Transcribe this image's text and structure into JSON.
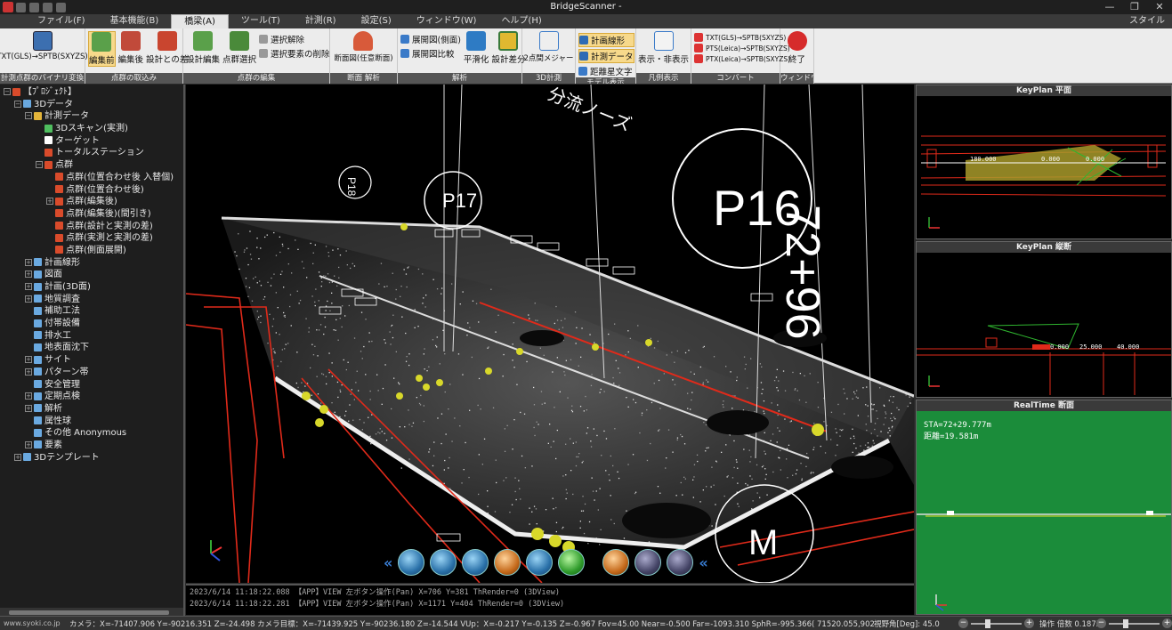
{
  "window": {
    "title": "BridgeScanner -",
    "controls": [
      "—",
      "❐",
      "✕"
    ]
  },
  "menu": {
    "items": [
      "ファイル(F)",
      "基本機能(B)",
      "橋梁(A)",
      "ツール(T)",
      "計測(R)",
      "設定(S)",
      "ウィンドウ(W)",
      "ヘルプ(H)"
    ],
    "style_label": "スタイル"
  },
  "ribbon": {
    "groups": [
      {
        "label": "計測点群のバイナリ変換",
        "buttons": [
          "TXT(GLS)→SPTB(SXYZS)"
        ]
      },
      {
        "label": "点群の取込み",
        "buttons": [
          "編集前",
          "編集後",
          "設計との差"
        ]
      },
      {
        "label": "点群の編集",
        "buttons": [
          "設計編集",
          "点群選択"
        ],
        "small": [
          "選択解除",
          "選択要素の削除"
        ]
      },
      {
        "label": "断面 解析",
        "buttons": [
          "断面図(任意断面)"
        ]
      },
      {
        "label": "解析",
        "small": [
          "展開図(側面)",
          "展開図比較"
        ],
        "buttons": [
          "平滑化",
          "設計差分"
        ]
      },
      {
        "label": "3D計測",
        "buttons": [
          "2点間メジャー"
        ]
      },
      {
        "label": "モデル表示",
        "small": [
          "計画線形",
          "計測データ",
          "距離星文字"
        ]
      },
      {
        "label": "凡例表示",
        "buttons": [
          "表示・非表示"
        ]
      },
      {
        "label": "コンバート",
        "small": [
          "TXT(GLS)→SPTB(SXYZS)",
          "PTS(Leica)→SPTB(SXYZS)",
          "PTX(Leica)→SPTB(SXYZS)"
        ]
      },
      {
        "label": "ウィンドウ",
        "buttons": [
          "終了"
        ]
      }
    ]
  },
  "tree": [
    {
      "level": 0,
      "label": "【ﾌﾟﾛｼﾞｪｸﾄ】",
      "icon": "project-icon",
      "color": "#d94b2b",
      "exp": "−"
    },
    {
      "level": 1,
      "label": "3Dデータ",
      "icon": "3d-icon",
      "color": "#6aa9e0",
      "exp": "−"
    },
    {
      "level": 2,
      "label": "計測データ",
      "icon": "folder-icon",
      "color": "#e3b43a",
      "exp": "−"
    },
    {
      "level": 3,
      "label": "3Dスキャン(実測)",
      "icon": "scan-icon",
      "color": "#4fbf5f",
      "exp": ""
    },
    {
      "level": 3,
      "label": "ターゲット",
      "icon": "target-icon",
      "color": "#ffffff",
      "exp": ""
    },
    {
      "level": 3,
      "label": "トータルステーション",
      "icon": "station-icon",
      "color": "#d94b2b",
      "exp": ""
    },
    {
      "level": 3,
      "label": "点群",
      "icon": "pointcloud-icon",
      "color": "#d94b2b",
      "exp": "−"
    },
    {
      "level": 4,
      "label": "点群(位置合わせ後 入替個)",
      "icon": "pointcloud-icon",
      "color": "#d94b2b",
      "exp": ""
    },
    {
      "level": 4,
      "label": "点群(位置合わせ後)",
      "icon": "pointcloud-icon",
      "color": "#d94b2b",
      "exp": ""
    },
    {
      "level": 4,
      "label": "点群(編集後)",
      "icon": "pointcloud-icon",
      "color": "#d94b2b",
      "exp": "+"
    },
    {
      "level": 4,
      "label": "点群(編集後)(間引き)",
      "icon": "pointcloud-icon",
      "color": "#d94b2b",
      "exp": ""
    },
    {
      "level": 4,
      "label": "点群(設計と実測の差)",
      "icon": "pointcloud-icon",
      "color": "#d94b2b",
      "exp": ""
    },
    {
      "level": 4,
      "label": "点群(実測と実測の差)",
      "icon": "pointcloud-icon",
      "color": "#d94b2b",
      "exp": ""
    },
    {
      "level": 4,
      "label": "点群(側面展開)",
      "icon": "pointcloud-icon",
      "color": "#d94b2b",
      "exp": ""
    },
    {
      "level": 2,
      "label": "計画線形",
      "icon": "gear-icon",
      "color": "#6aa9e0",
      "exp": "+"
    },
    {
      "level": 2,
      "label": "図面",
      "icon": "gear-icon",
      "color": "#6aa9e0",
      "exp": "+"
    },
    {
      "level": 2,
      "label": "計画(3D面)",
      "icon": "gear-icon",
      "color": "#6aa9e0",
      "exp": "+"
    },
    {
      "level": 2,
      "label": "地質調査",
      "icon": "gear-icon",
      "color": "#6aa9e0",
      "exp": "+"
    },
    {
      "level": 2,
      "label": "補助工法",
      "icon": "gear-icon",
      "color": "#6aa9e0",
      "exp": ""
    },
    {
      "level": 2,
      "label": "付帯設備",
      "icon": "gear-icon",
      "color": "#6aa9e0",
      "exp": ""
    },
    {
      "level": 2,
      "label": "排水工",
      "icon": "gear-icon",
      "color": "#6aa9e0",
      "exp": ""
    },
    {
      "level": 2,
      "label": "地表面沈下",
      "icon": "gear-icon",
      "color": "#6aa9e0",
      "exp": ""
    },
    {
      "level": 2,
      "label": "サイト",
      "icon": "gear-icon",
      "color": "#6aa9e0",
      "exp": "+"
    },
    {
      "level": 2,
      "label": "パターン帯",
      "icon": "gear-icon",
      "color": "#6aa9e0",
      "exp": "+"
    },
    {
      "level": 2,
      "label": "安全管理",
      "icon": "gear-icon",
      "color": "#6aa9e0",
      "exp": ""
    },
    {
      "level": 2,
      "label": "定期点検",
      "icon": "gear-icon",
      "color": "#6aa9e0",
      "exp": "+"
    },
    {
      "level": 2,
      "label": "解析",
      "icon": "gear-icon",
      "color": "#6aa9e0",
      "exp": "+"
    },
    {
      "level": 2,
      "label": "属性球",
      "icon": "gear-icon",
      "color": "#6aa9e0",
      "exp": ""
    },
    {
      "level": 2,
      "label": "その他 Anonymous",
      "icon": "gear-icon",
      "color": "#6aa9e0",
      "exp": ""
    },
    {
      "level": 2,
      "label": "要素",
      "icon": "gear-icon",
      "color": "#6aa9e0",
      "exp": "+"
    },
    {
      "level": 1,
      "label": "3Dテンプレート",
      "icon": "3d-icon",
      "color": "#6aa9e0",
      "exp": "+"
    }
  ],
  "viewport": {
    "labels": {
      "p16": "P16",
      "p17": "P17",
      "p18": "P18",
      "m": "M",
      "station": "72+96",
      "note": "分流ノーズ"
    }
  },
  "log": [
    "2023/6/14 11:18:22.088 【APP】VIEW 左ボタン操作(Pan) X=706 Y=381 ThRender=0 (3DView)",
    "2023/6/14 11:18:22.281 【APP】VIEW 左ボタン操作(Pan) X=1171 Y=404 ThRender=0 (3DView)"
  ],
  "panels": {
    "keyplan_plan": "KeyPlan 平面",
    "keyplan_section": "KeyPlan 縦断",
    "realtime": "RealTime 断面",
    "realtime_sta": "STA=72+29.777m",
    "realtime_dist": "距離=19.581m",
    "keyplan_plan_dims": [
      "180.000",
      "0.000",
      "0.000"
    ],
    "keyplan_section_dims": [
      "0.000",
      "25.000",
      "40.000"
    ]
  },
  "status": {
    "site": "www.syoki.co.jp",
    "coords": "カメラ：X=-71407.906 Y=-90216.351 Z=-24.498 カメラ目標：X=-71439.925 Y=-90236.180 Z=-14.544 VUp：X=-0.217 Y=-0.135 Z=-0.967 Fov=45.00 Near=-0.500 Far=-1093.310 SphR=-995.366( 71520.055,90214.227, 10.000)",
    "fov": "視野角[Deg]: 45.0",
    "speed": "操作 倍数 0.187X"
  }
}
